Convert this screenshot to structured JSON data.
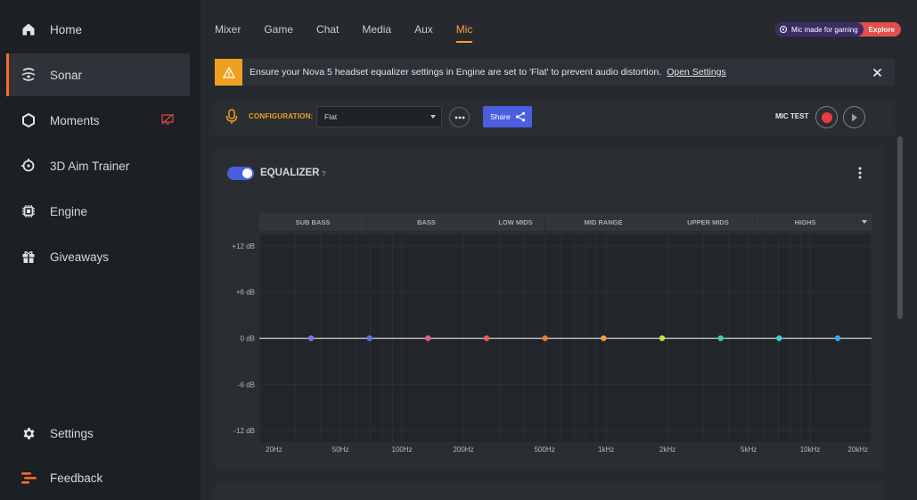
{
  "sidebar": {
    "items": [
      {
        "label": "Home",
        "icon": "home-icon"
      },
      {
        "label": "Sonar",
        "icon": "sonar-icon",
        "active": true
      },
      {
        "label": "Moments",
        "icon": "moments-icon"
      },
      {
        "label": "3D Aim Trainer",
        "icon": "aim-trainer-icon"
      },
      {
        "label": "Engine",
        "icon": "engine-icon"
      },
      {
        "label": "Giveaways",
        "icon": "gift-icon"
      }
    ],
    "bottom": [
      {
        "label": "Settings",
        "icon": "gear-icon"
      },
      {
        "label": "Feedback",
        "icon": "feedback-icon"
      }
    ]
  },
  "tabs": [
    "Mixer",
    "Game",
    "Chat",
    "Media",
    "Aux",
    "Mic"
  ],
  "active_tab": "Mic",
  "promo": {
    "text": "Mic made for gaming",
    "action": "Explore"
  },
  "banner": {
    "message": "Ensure your Nova 5 headset equalizer settings in Engine are set to 'Flat' to prevent audio distortion.",
    "link": "Open Settings"
  },
  "config": {
    "label": "CONFIGURATION:",
    "selected": "Flat",
    "share_label": "Share",
    "mic_test_label": "MIC TEST"
  },
  "equalizer": {
    "title": "EQUALIZER",
    "help": "?",
    "enabled": true,
    "bands": [
      "SUB BASS",
      "BASS",
      "LOW MIDS",
      "MID RANGE",
      "UPPER MIDS",
      "HIGHS"
    ],
    "db_labels": [
      "+12 dB",
      "+6 dB",
      "0 dB",
      "-6 dB",
      "-12 dB"
    ],
    "freq_labels": [
      "20Hz",
      "50Hz",
      "100Hz",
      "200Hz",
      "500Hz",
      "1kHz",
      "2kHz",
      "5kHz",
      "10kHz",
      "20kHz"
    ],
    "point_gains_db": [
      0,
      0,
      0,
      0,
      0,
      0,
      0,
      0,
      0,
      0
    ],
    "point_colors": [
      "#8a6cf0",
      "#5b74e8",
      "#e8589b",
      "#ee5a5a",
      "#f07a3a",
      "#f0a23a",
      "#c8e04a",
      "#3ad6a0",
      "#3ad0e0",
      "#3aa8ee"
    ]
  },
  "colors": {
    "accent": "#ff9a3d",
    "primary_button": "#4a5fe0",
    "warning": "#f0a020",
    "record": "#ec3b3b"
  }
}
